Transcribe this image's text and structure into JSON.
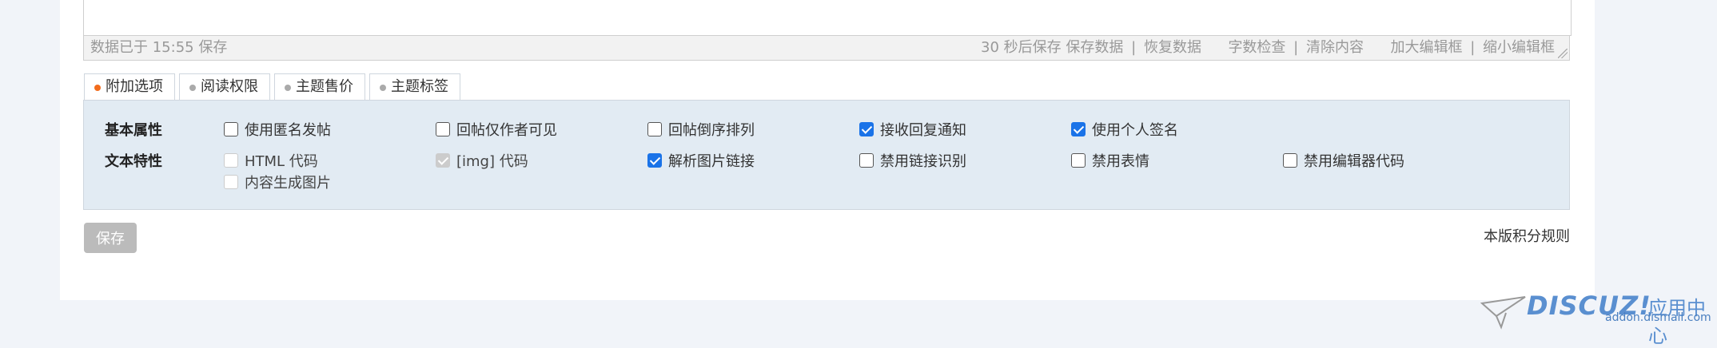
{
  "status_bar": {
    "saved_text": "数据已于 15:55 保存",
    "autosave": "30 秒后保存",
    "save_data": "保存数据",
    "sep": "|",
    "restore_data": "恢复数据",
    "word_check": "字数检查",
    "clear_content": "清除内容",
    "enlarge": "加大编辑框",
    "shrink": "缩小编辑框"
  },
  "tabs": [
    {
      "label": "附加选项",
      "active": true
    },
    {
      "label": "阅读权限",
      "active": false
    },
    {
      "label": "主题售价",
      "active": false
    },
    {
      "label": "主题标签",
      "active": false
    }
  ],
  "options": {
    "basic_label": "基本属性",
    "text_label": "文本特性",
    "basic": [
      {
        "label": "使用匿名发帖",
        "checked": false
      },
      {
        "label": "回帖仅作者可见",
        "checked": false
      },
      {
        "label": "回帖倒序排列",
        "checked": false
      },
      {
        "label": "接收回复通知",
        "checked": true
      },
      {
        "label": "使用个人签名",
        "checked": true
      }
    ],
    "text": [
      {
        "label": "HTML 代码",
        "checked": false,
        "disabled": true
      },
      {
        "label": "[img] 代码",
        "checked": true,
        "disabled": true
      },
      {
        "label": "解析图片链接",
        "checked": true,
        "disabled": false
      },
      {
        "label": "禁用链接识别",
        "checked": false,
        "disabled": false
      },
      {
        "label": "禁用表情",
        "checked": false,
        "disabled": false
      },
      {
        "label": "禁用编辑器代码",
        "checked": false,
        "disabled": false
      },
      {
        "label": "内容生成图片",
        "checked": false,
        "disabled": true
      }
    ]
  },
  "save_button": "保存",
  "rules_link": "本版积分规则",
  "watermark": {
    "logo": "DISCUZ!",
    "cn": "应用中心",
    "url": "addon.dismall.com"
  },
  "colors": {
    "accent": "#1a73e8",
    "active_tab_dot": "#f26c1c",
    "panel_bg": "#e2ebf3",
    "page_bg": "#f1f4f9"
  }
}
